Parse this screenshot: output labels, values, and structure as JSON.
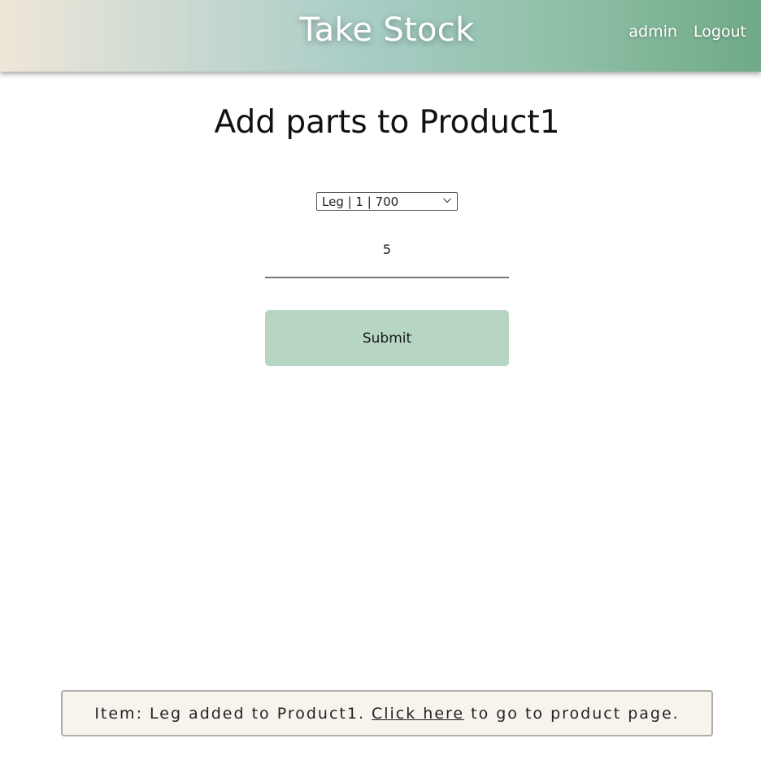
{
  "header": {
    "brand": "Take Stock",
    "nav": {
      "user": "admin",
      "logout": "Logout"
    }
  },
  "main": {
    "title": "Add parts to Product1",
    "part_select": {
      "selected": "Leg | 1 | 700"
    },
    "quantity": {
      "value": "5"
    },
    "submit_label": "Submit"
  },
  "alert": {
    "prefix": "Item: Leg added to Product1.",
    "link_text": "Click here",
    "suffix": "to go to product page."
  },
  "colors": {
    "submit_bg": "#b6d5c3",
    "header_gradient_start": "#efe6d8",
    "header_gradient_end": "#6faa87",
    "alert_bg": "#f7f4ee"
  }
}
